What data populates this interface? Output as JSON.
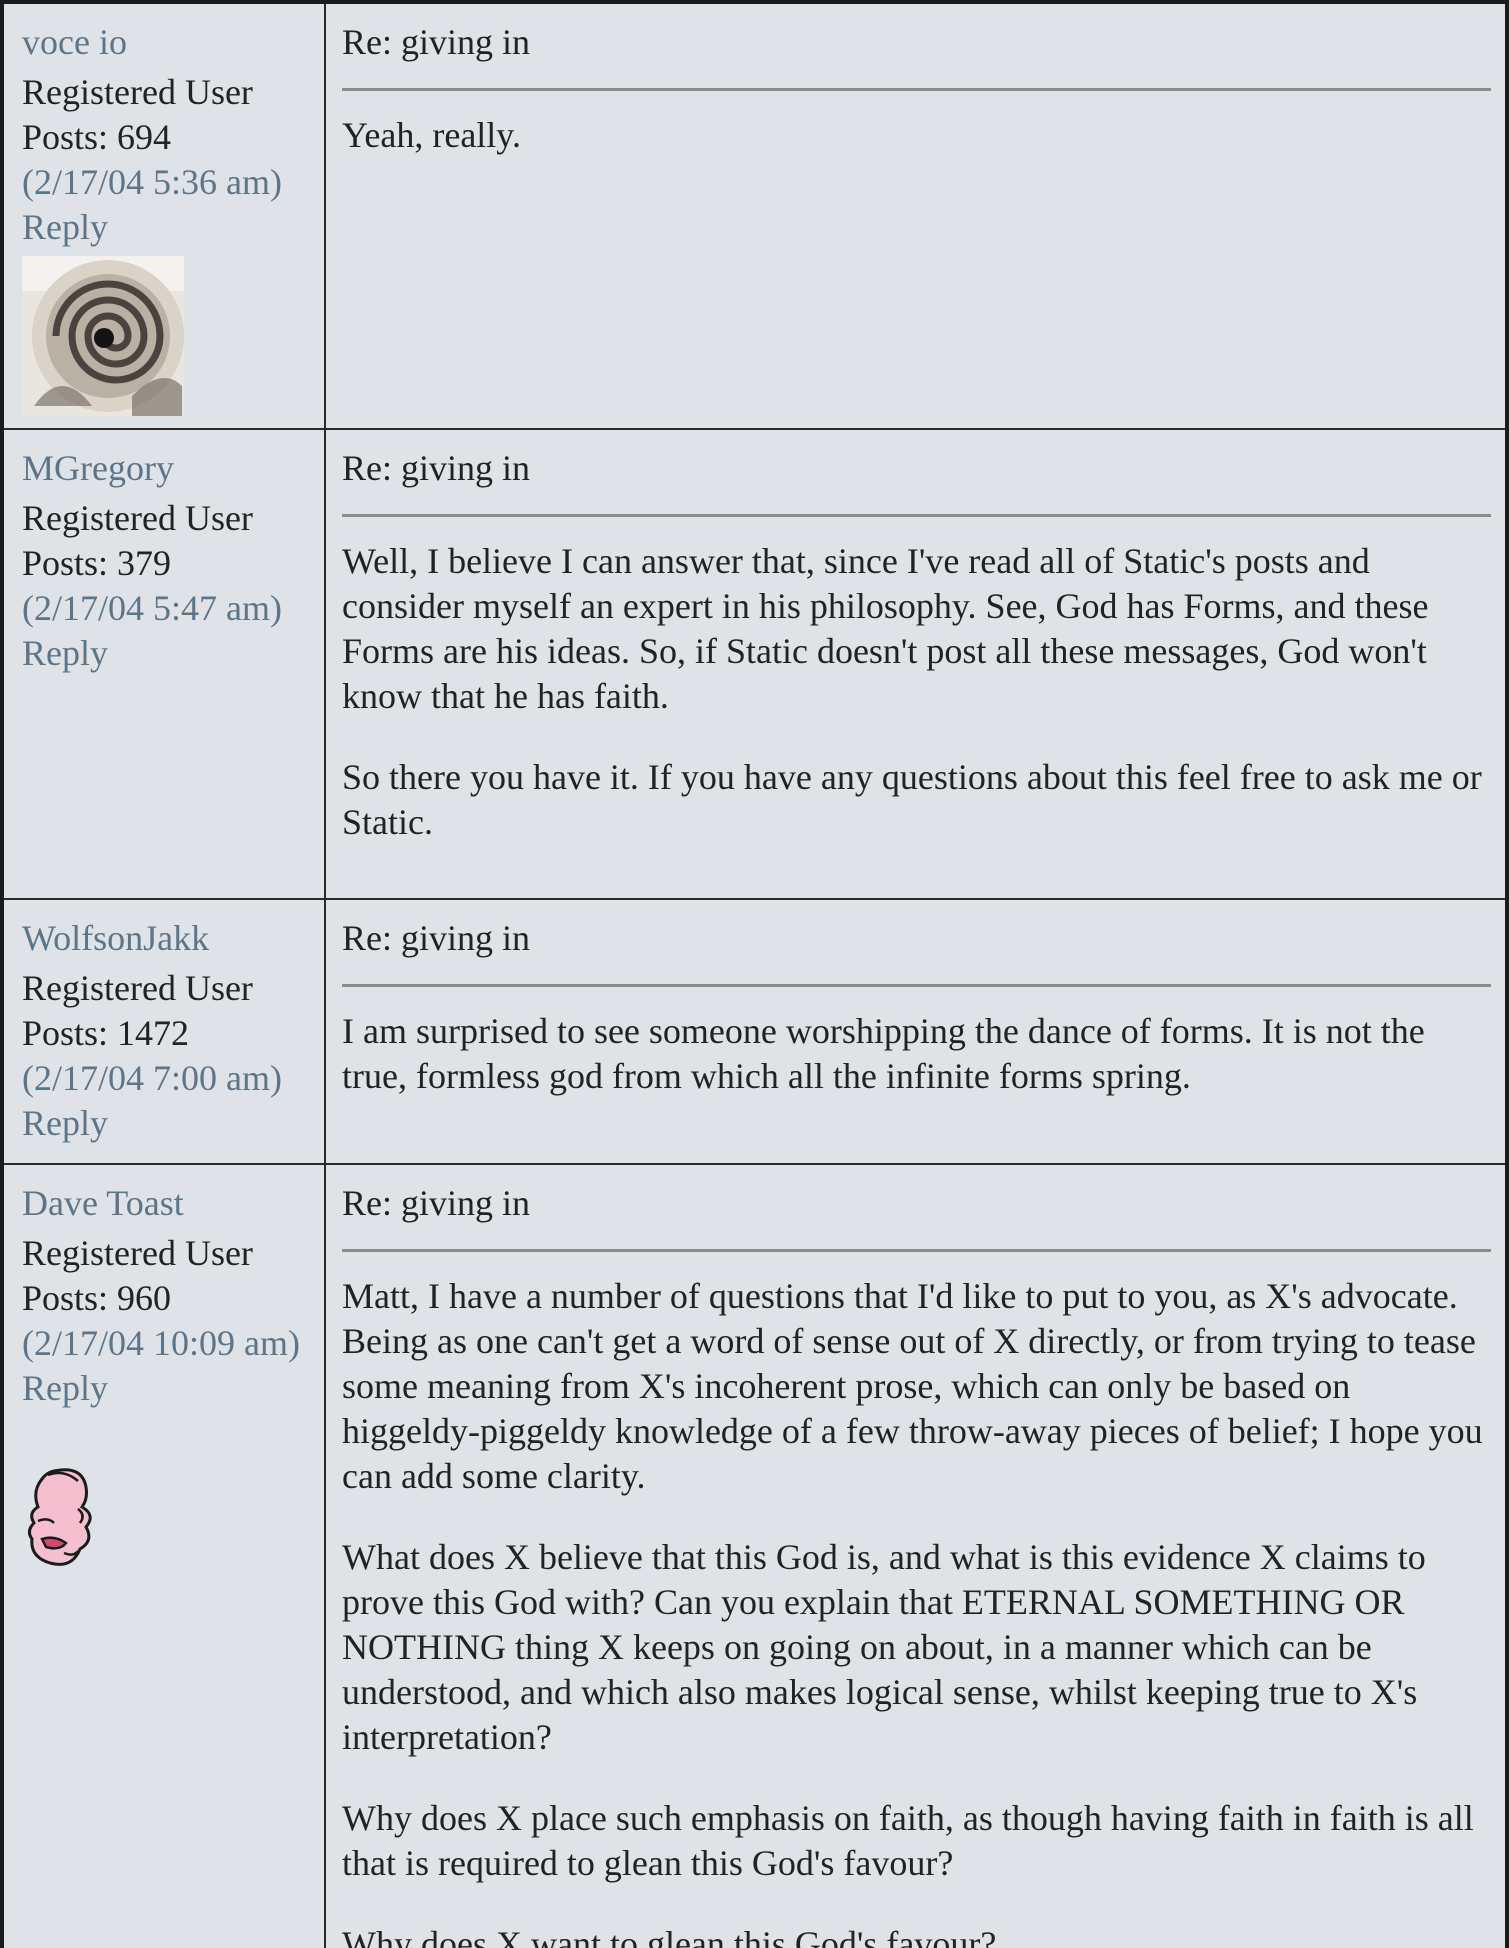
{
  "posts": [
    {
      "author": "voce io",
      "role": "Registered User",
      "posts": "Posts: 694",
      "date": "(2/17/04 5:36 am)",
      "reply": "Reply",
      "avatar": "spiral-staircase-photo",
      "title": "Re: giving in",
      "body": [
        "Yeah, really."
      ]
    },
    {
      "author": "MGregory",
      "role": "Registered User",
      "posts": "Posts: 379",
      "date": "(2/17/04 5:47 am)",
      "reply": "Reply",
      "title": "Re: giving in",
      "body": [
        "Well, I believe I can answer that, since I've read all of Static's posts and consider myself an expert in his philosophy. See, God has Forms, and these Forms are his ideas. So, if Static doesn't post all these messages, God won't know that he has faith.",
        "So there you have it. If you have any questions about this feel free to ask me or Static."
      ]
    },
    {
      "author": "WolfsonJakk",
      "role": "Registered User",
      "posts": "Posts: 1472",
      "date": "(2/17/04 7:00 am)",
      "reply": "Reply",
      "title": "Re: giving in",
      "body": [
        "I am surprised to see someone worshipping the dance of forms. It is not the true, formless god from which all the infinite forms spring."
      ]
    },
    {
      "author": "Dave Toast",
      "role": "Registered User",
      "posts": "Posts: 960",
      "date": "(2/17/04 10:09 am)",
      "reply": "Reply",
      "avatar": "cartoon-face",
      "title": "Re: giving in",
      "body": [
        "Matt, I have a number of questions that I'd like to put to you, as X's advocate. Being as one can't get a word of sense out of X directly, or from trying to tease some meaning from X's incoherent prose, which can only be based on higgeldy-piggeldy knowledge of a few throw-away pieces of belief; I hope you can add some clarity.",
        "What does X believe that this God is, and what is this evidence X claims to prove this God with? Can you explain that ETERNAL SOMETHING OR NOTHING thing X keeps on going on about, in a manner which can be understood, and which also makes logical sense, whilst keeping true to X's interpretation?",
        "Why does X place such emphasis on faith, as though having faith in faith is all that is required to glean this God's favour?",
        "Why does X want to glean this God's favour?"
      ]
    }
  ],
  "colors": {
    "background": "#dfe3e7",
    "link": "#5d7589",
    "text": "#222222",
    "divider": "#8b8b8b"
  }
}
